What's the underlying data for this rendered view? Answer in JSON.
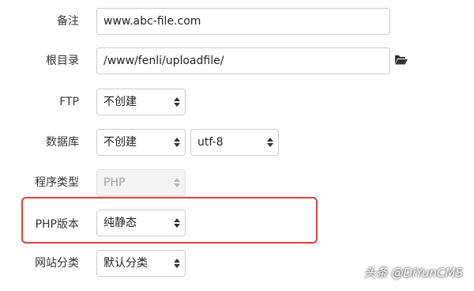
{
  "form": {
    "remark": {
      "label": "备注",
      "value": "www.abc-file.com"
    },
    "root_dir": {
      "label": "根目录",
      "value": "/www/fenli/uploadfile/"
    },
    "ftp": {
      "label": "FTP",
      "value": "不创建"
    },
    "database": {
      "label": "数据库",
      "value": "不创建",
      "charset": "utf-8"
    },
    "program_type": {
      "label": "程序类型",
      "value": "PHP"
    },
    "php_version": {
      "label": "PHP版本",
      "value": "纯静态"
    },
    "site_category": {
      "label": "网站分类",
      "value": "默认分类"
    }
  },
  "icons": {
    "folder": "folder-open-icon",
    "select_caret": "up-down-caret-icon"
  },
  "colors": {
    "highlight_border": "#d9433c"
  },
  "watermark": "头条 @DiYunCMS"
}
